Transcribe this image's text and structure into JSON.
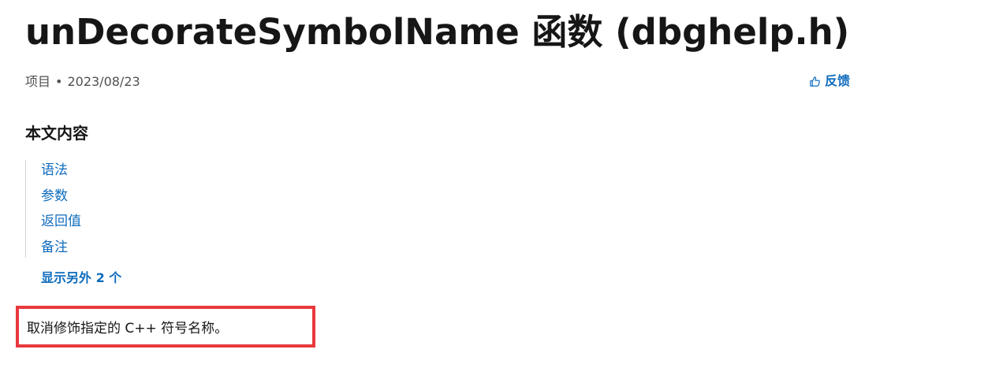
{
  "header": {
    "title": "unDecorateSymbolName 函数 (dbghelp.h)",
    "category": "项目",
    "separator": "•",
    "date": "2023/08/23",
    "feedback_label": "反馈",
    "feedback_icon": "thumbs-up-icon"
  },
  "toc": {
    "heading": "本文内容",
    "items": [
      {
        "label": "语法"
      },
      {
        "label": "参数"
      },
      {
        "label": "返回值"
      },
      {
        "label": "备注"
      }
    ],
    "show_more_label": "显示另外 2 个"
  },
  "content": {
    "description": "取消修饰指定的 C++ 符号名称。"
  },
  "colors": {
    "link": "#0f6cbd",
    "highlight_border": "#e8383d",
    "text": "#161616"
  }
}
